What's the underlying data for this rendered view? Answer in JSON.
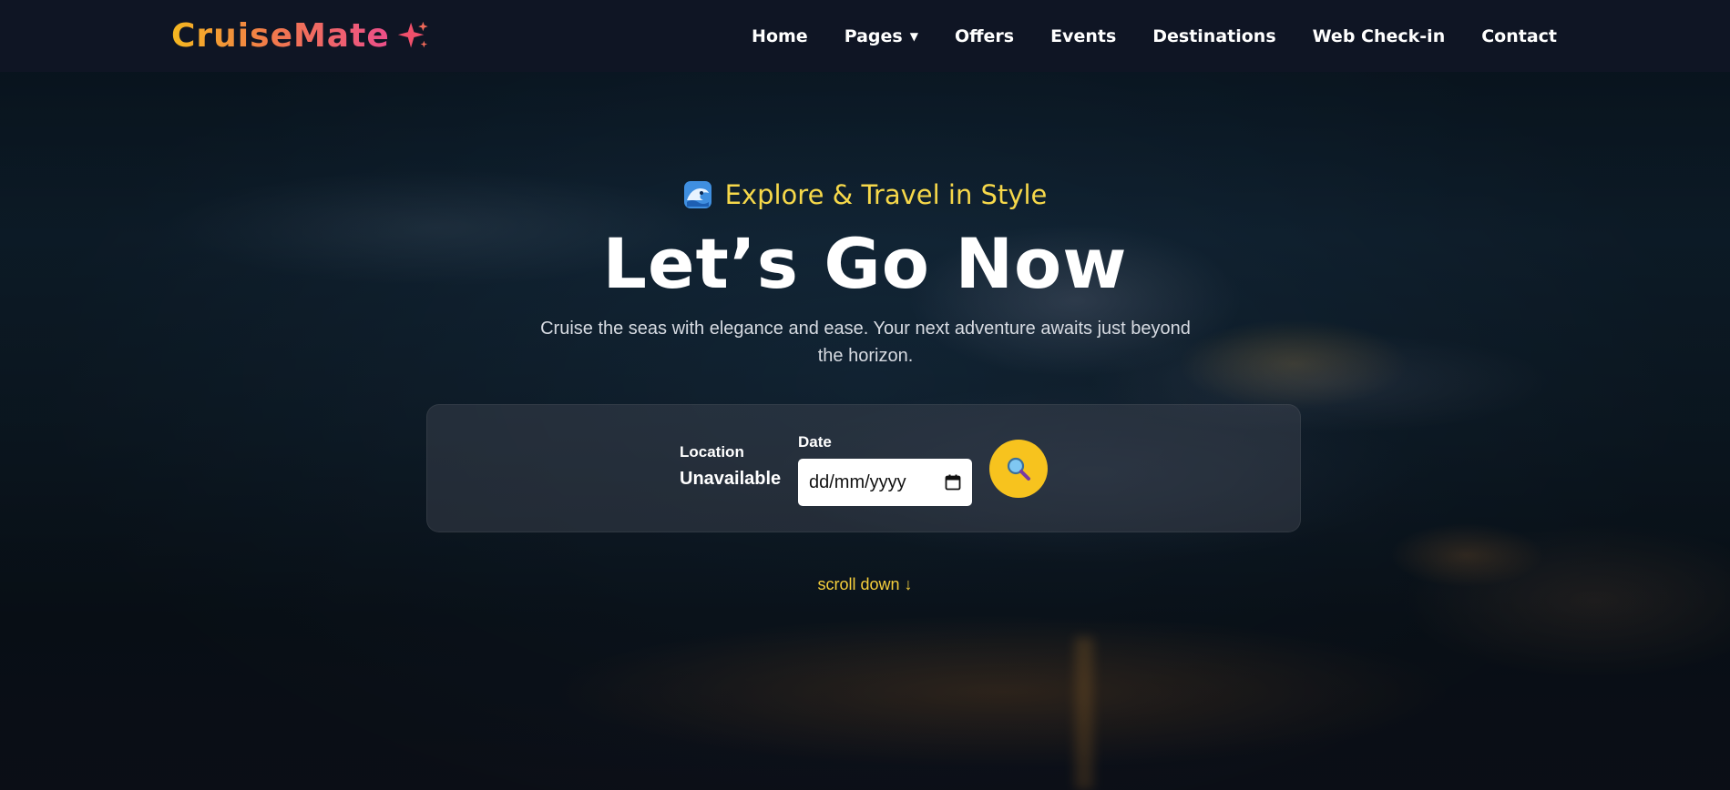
{
  "brand": {
    "name": "CruiseMate",
    "icon": "sparkle-icon",
    "gradient_start": "#f5b820",
    "gradient_end": "#ec4e8a"
  },
  "nav": {
    "items": [
      {
        "label": "Home"
      },
      {
        "label": "Pages",
        "has_dropdown": true,
        "caret": "▼"
      },
      {
        "label": "Offers"
      },
      {
        "label": "Events"
      },
      {
        "label": "Destinations"
      },
      {
        "label": "Web Check-in"
      },
      {
        "label": "Contact"
      }
    ]
  },
  "hero": {
    "tagline": "Explore & Travel in Style",
    "tagline_icon": "wave-icon",
    "title": "Let’s Go Now",
    "subtitle": "Cruise the seas with elegance and ease. Your next adventure awaits just beyond the horizon."
  },
  "search": {
    "location_label": "Location",
    "location_value": "Unavailable",
    "date_label": "Date",
    "date_placeholder": "dd/mm/yyyy",
    "button_icon": "magnifier-icon",
    "button_color": "#f7c31e"
  },
  "scroll_hint": "scroll down ↓",
  "colors": {
    "navbar_bg": "#0f1524",
    "accent_yellow": "#f6d84a",
    "text_white": "#ffffff"
  }
}
